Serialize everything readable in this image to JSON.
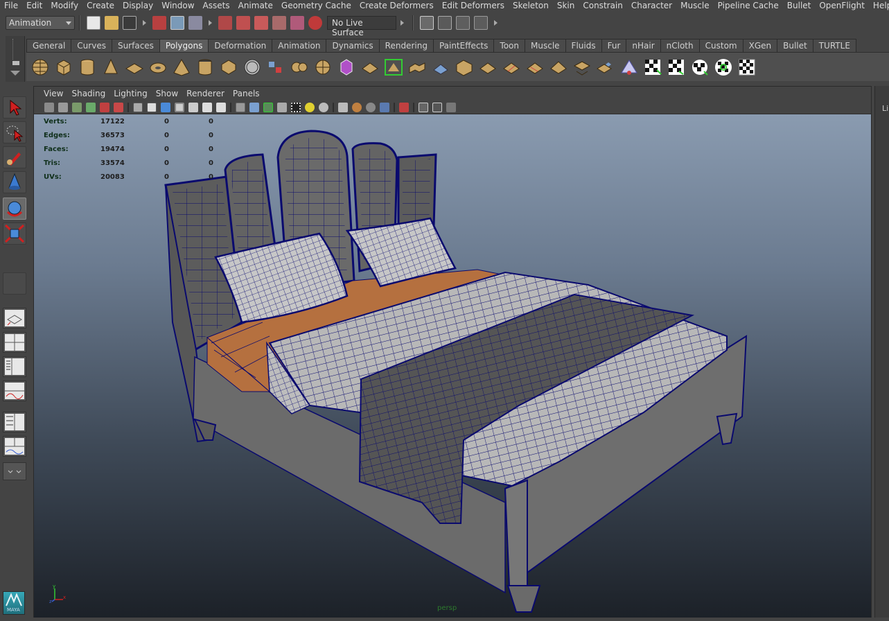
{
  "menubar": [
    "File",
    "Edit",
    "Modify",
    "Create",
    "Display",
    "Window",
    "Assets",
    "Animate",
    "Geometry Cache",
    "Create Deformers",
    "Edit Deformers",
    "Skeleton",
    "Skin",
    "Constrain",
    "Character",
    "Muscle",
    "Pipeline Cache",
    "Bullet",
    "OpenFlight",
    "Help"
  ],
  "status_line": {
    "mode": "Animation",
    "live_surface": "No Live Surface"
  },
  "shelf": {
    "tabs": [
      "General",
      "Curves",
      "Surfaces",
      "Polygons",
      "Deformation",
      "Animation",
      "Dynamics",
      "Rendering",
      "PaintEffects",
      "Toon",
      "Muscle",
      "Fluids",
      "Fur",
      "nHair",
      "nCloth",
      "Custom",
      "XGen",
      "Bullet",
      "TURTLE"
    ],
    "active_tab": "Polygons"
  },
  "panel": {
    "menus": [
      "View",
      "Shading",
      "Lighting",
      "Show",
      "Renderer",
      "Panels"
    ],
    "camera": "persp"
  },
  "hud": [
    {
      "label": "Verts:",
      "v1": "17122",
      "v2": "0",
      "v3": "0"
    },
    {
      "label": "Edges:",
      "v1": "36573",
      "v2": "0",
      "v3": "0"
    },
    {
      "label": "Faces:",
      "v1": "19474",
      "v2": "0",
      "v3": "0"
    },
    {
      "label": "Tris:",
      "v1": "33574",
      "v2": "0",
      "v3": "0"
    },
    {
      "label": "UVs:",
      "v1": "20083",
      "v2": "0",
      "v3": "0"
    }
  ],
  "axis": {
    "y": "y",
    "x": "x",
    "z": "z"
  },
  "logo_text": "MAYA",
  "right_panel_label": "Li",
  "colors": {
    "wire": "#0a0a6e",
    "sheet": "#b5703f",
    "frame": "#6a6a6a"
  }
}
